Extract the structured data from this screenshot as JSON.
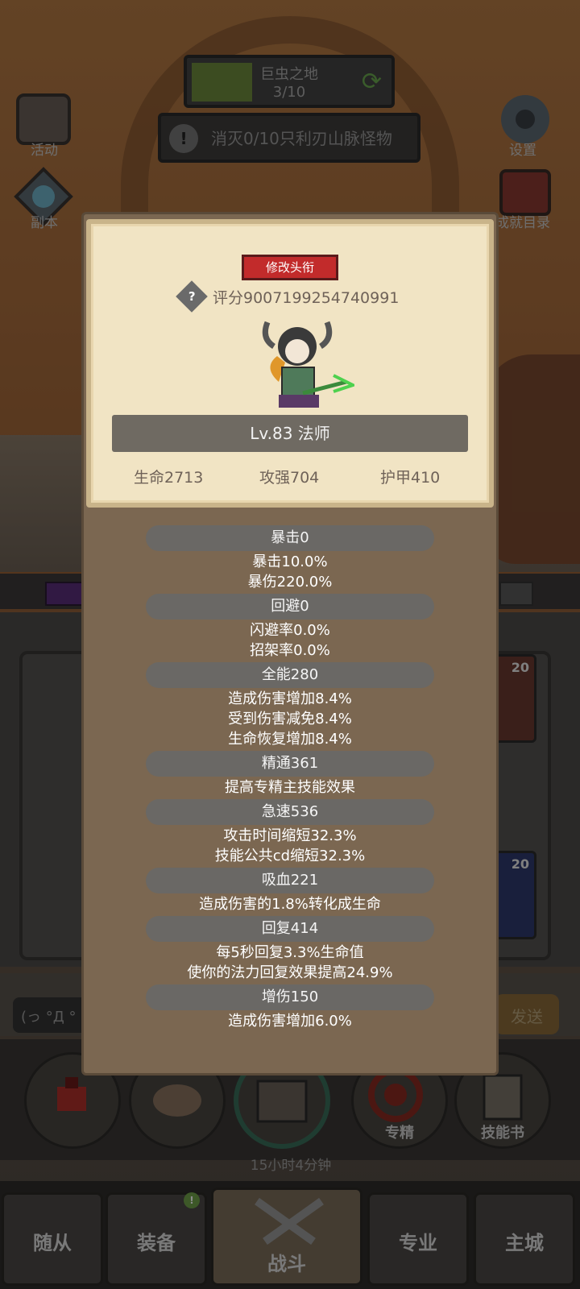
{
  "hud": {
    "region_name": "巨虫之地",
    "region_progress": "3/10",
    "region_fill_fraction": 0.3,
    "quest_text": "消灭0/10只利刃山脉怪物",
    "left_icons": [
      {
        "label": "活动"
      },
      {
        "label": "副本"
      }
    ],
    "right_icons": [
      {
        "label": "设置"
      },
      {
        "label": "成就目录"
      }
    ]
  },
  "character": {
    "title_button": "修改头衔",
    "score_label": "评分9007199254740991",
    "level_class": "Lv.83 法师",
    "stats": [
      {
        "text": "生命2713"
      },
      {
        "text": "攻强704"
      },
      {
        "text": "护甲410"
      }
    ]
  },
  "attributes": [
    {
      "header": "暴击0",
      "lines": [
        "暴击10.0%",
        "暴伤220.0%"
      ]
    },
    {
      "header": "回避0",
      "lines": [
        "闪避率0.0%",
        "招架率0.0%"
      ]
    },
    {
      "header": "全能280",
      "lines": [
        "造成伤害增加8.4%",
        "受到伤害减免8.4%",
        "生命恢复增加8.4%"
      ]
    },
    {
      "header": "精通361",
      "lines": [
        "提高专精主技能效果"
      ]
    },
    {
      "header": "急速536",
      "lines": [
        "攻击时间缩短32.3%",
        "技能公共cd缩短32.3%"
      ]
    },
    {
      "header": "吸血221",
      "lines": [
        "造成伤害的1.8%转化成生命"
      ]
    },
    {
      "header": "回复414",
      "lines": [
        "每5秒回复3.3%生命值",
        "使你的法力回复效果提高24.9%"
      ]
    },
    {
      "header": "增伤150",
      "lines": [
        "造成伤害增加6.0%"
      ]
    }
  ],
  "chat": {
    "input_text": "(っ °Д °",
    "send_label": "发送"
  },
  "actions": {
    "timer": "15小时4分钟",
    "specialize_label": "专精",
    "skillbook_label": "技能书"
  },
  "inventory": {
    "slot_levels": [
      "20",
      "20"
    ]
  },
  "nav": [
    {
      "label": "随从"
    },
    {
      "label": "装备"
    },
    {
      "label": "战斗"
    },
    {
      "label": "专业"
    },
    {
      "label": "主城"
    }
  ],
  "colors": {
    "title_button": "#c22b2b",
    "panel": "#7b6751",
    "card": "#f1e4c4"
  }
}
